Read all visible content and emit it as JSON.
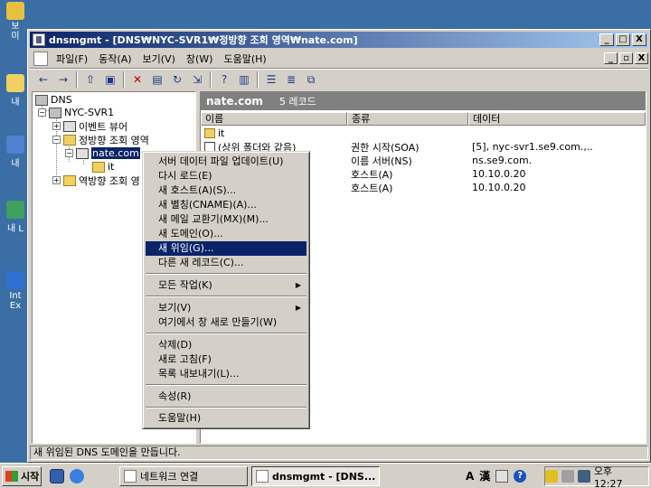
{
  "desktop": {
    "icons": [
      {
        "label": "보\n미",
        "color": "#e8c040"
      },
      {
        "label": "내",
        "color": "#f0d060"
      },
      {
        "label": "내",
        "color": "#5080d0"
      },
      {
        "label": "내 L",
        "color": "#40a060"
      },
      {
        "label": "Int\nEx",
        "color": "#3070d0"
      }
    ]
  },
  "window": {
    "title": "dnsmgmt - [DNS₩NYC-SVR1₩정방향 조회 영역₩nate.com]",
    "controls": {
      "minimize": "_",
      "maximize": "□",
      "close": "X"
    },
    "mdi_controls": {
      "minimize": "_",
      "restore": "▫",
      "close": "X"
    }
  },
  "menubar": {
    "items": [
      "파일(F)",
      "동작(A)",
      "보기(V)",
      "창(W)",
      "도움말(H)"
    ]
  },
  "toolbar": {
    "buttons": [
      "back-icon",
      "forward-icon",
      "up-folder-icon",
      "show-tree-icon",
      "delete-icon",
      "properties-icon",
      "refresh-icon",
      "export-icon",
      "help-icon",
      "console-icon",
      "list-icon",
      "details-icon",
      "filter-icon"
    ]
  },
  "tree": {
    "root": "DNS",
    "server": "NYC-SVR1",
    "event_viewer": "이벤트 뷰어",
    "forward_zones": "정방향 조회 영역",
    "zone": "nate.com",
    "subfolder": "it",
    "reverse_zones": "역방향 조회 영"
  },
  "details": {
    "header_title": "nate.com",
    "record_count": "5 레코드",
    "columns": [
      "이름",
      "종류",
      "데이터"
    ],
    "rows": [
      {
        "name": "it",
        "type": "",
        "data": "",
        "icon": "folder"
      },
      {
        "name": "(상위 폴더와 같음)",
        "type": "권한 시작(SOA)",
        "data": "[5], nyc-svr1.se9.com.,..",
        "icon": "doc"
      },
      {
        "name": "",
        "type": "이름 서버(NS)",
        "data": "ns.se9.com.",
        "icon": ""
      },
      {
        "name": "",
        "type": "호스트(A)",
        "data": "10.10.0.20",
        "icon": ""
      },
      {
        "name": "",
        "type": "호스트(A)",
        "data": "10.10.0.20",
        "icon": ""
      }
    ]
  },
  "context_menu": {
    "items": [
      {
        "label": "서버 데이터 파일 업데이트(U)",
        "submenu": false,
        "highlighted": false
      },
      {
        "label": "다시 로드(E)",
        "submenu": false,
        "highlighted": false
      },
      {
        "label": "새 호스트(A)(S)...",
        "submenu": false,
        "highlighted": false
      },
      {
        "label": "새 별칭(CNAME)(A)...",
        "submenu": false,
        "highlighted": false
      },
      {
        "label": "새 메일 교환기(MX)(M)...",
        "submenu": false,
        "highlighted": false
      },
      {
        "label": "새 도메인(O)...",
        "submenu": false,
        "highlighted": false
      },
      {
        "label": "새 위임(G)...",
        "submenu": false,
        "highlighted": true
      },
      {
        "label": "다른 새 레코드(C)...",
        "submenu": false,
        "highlighted": false
      },
      {
        "label": "모든 작업(K)",
        "submenu": true,
        "highlighted": false
      },
      {
        "label": "보기(V)",
        "submenu": true,
        "highlighted": false
      },
      {
        "label": "여기에서 창 새로 만들기(W)",
        "submenu": false,
        "highlighted": false
      },
      {
        "label": "삭제(D)",
        "submenu": false,
        "highlighted": false
      },
      {
        "label": "새로 고침(F)",
        "submenu": false,
        "highlighted": false
      },
      {
        "label": "목록 내보내기(L)...",
        "submenu": false,
        "highlighted": false
      },
      {
        "label": "속성(R)",
        "submenu": false,
        "highlighted": false
      },
      {
        "label": "도움말(H)",
        "submenu": false,
        "highlighted": false
      }
    ]
  },
  "status_bar": {
    "text": "새 위임된 DNS 도메인을 만듭니다."
  },
  "taskbar": {
    "start_label": "시작",
    "tasks": [
      {
        "label": "네트워크 연결",
        "active": false
      },
      {
        "label": "dnsmgmt - [DNS...",
        "active": true
      }
    ],
    "ime": {
      "mode": "A",
      "hanja": "漢"
    },
    "clock": "오후 12:27"
  },
  "colors": {
    "desktop": "#3a6ea5",
    "title_active": "#0a246a",
    "face": "#d4d0c8",
    "highlight": "#0a246a"
  }
}
